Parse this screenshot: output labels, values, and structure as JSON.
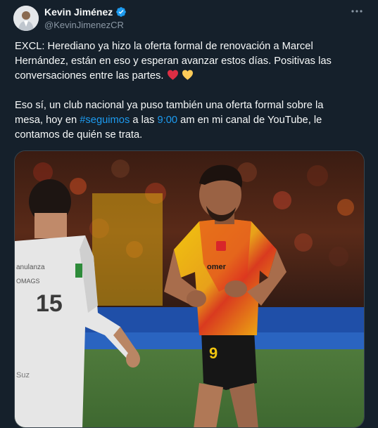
{
  "author": {
    "display_name": "Kevin Jiménez",
    "handle": "@KevinJimenezCR",
    "verified": true,
    "verified_color": "#1d9bf0"
  },
  "menu_icon": "more-horizontal-icon",
  "tweet": {
    "para1_line1": "EXCL: Herediano ya hizo la oferta formal de renovación a Marcel",
    "para1_line2": "Hernández, están en eso y esperan avanzar estos días. Positivas las",
    "para1_line3": "conversaciones entre las partes.",
    "emojis": [
      "red-heart",
      "yellow-heart"
    ],
    "para2_line1": "Eso sí, un club nacional ya puso también una oferta formal sobre la",
    "para2_line2_a": "mesa, hoy en ",
    "hashtag": "#seguimos",
    "para2_line2_b": " a las ",
    "time": "9:00",
    "para2_line2_c": " am en mi canal de YouTube, le",
    "para2_line3": "contamos de quién se trata."
  },
  "media": {
    "description_icon": "soccer-photo",
    "jersey_number": "9",
    "jersey_sponsor": "omer",
    "opponent_number": "15",
    "opponent_sponsor_1": "anulanza",
    "opponent_sponsor_2": "OMAGS",
    "opponent_sponsor_3": "Suz"
  },
  "colors": {
    "background": "#15202b",
    "text": "#f7f9f9",
    "secondary": "#8b98a5",
    "link": "#1d9bf0"
  }
}
